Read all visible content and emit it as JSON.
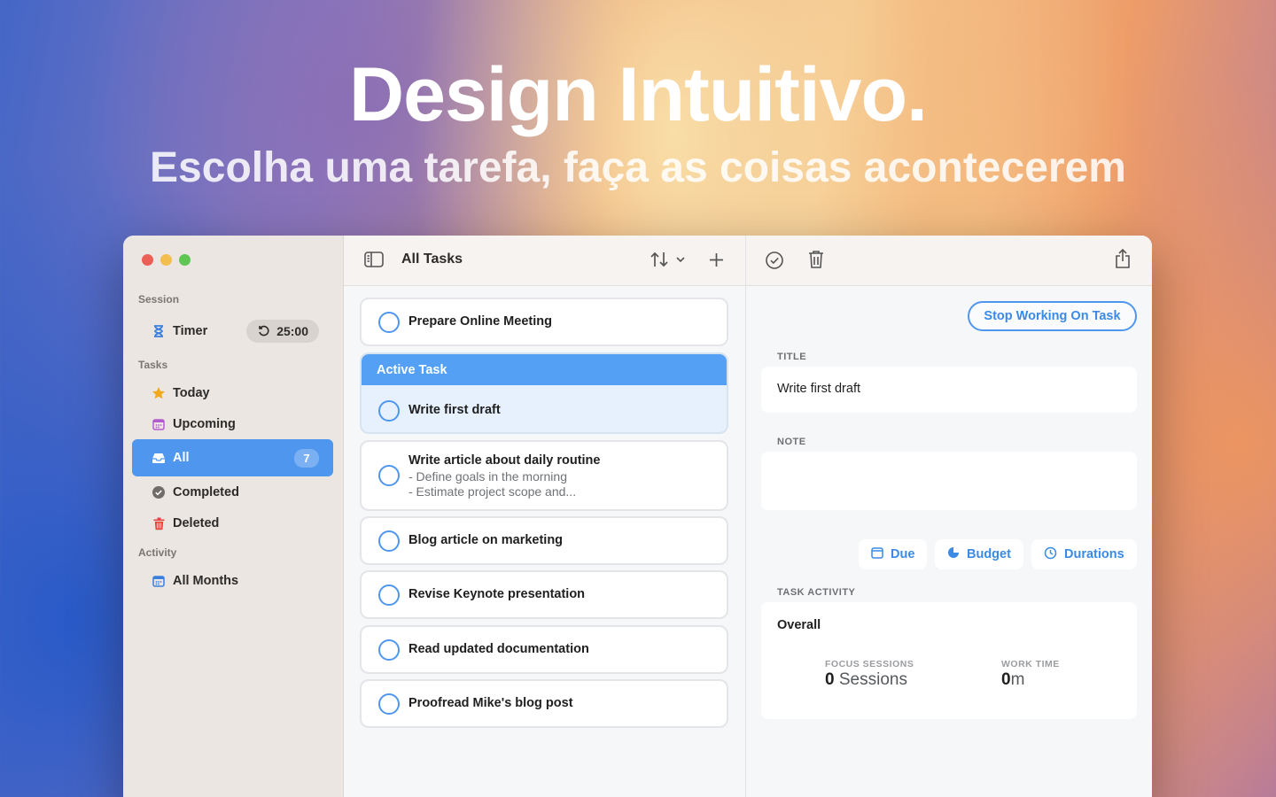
{
  "hero": {
    "title": "Design Intuitivo.",
    "subtitle": "Escolha uma tarefa, faça as coisas acontecerem"
  },
  "sidebar": {
    "session_label": "Session",
    "timer": {
      "label": "Timer",
      "value": "25:00"
    },
    "tasks_label": "Tasks",
    "items": [
      {
        "label": "Today",
        "icon": "star-icon"
      },
      {
        "label": "Upcoming",
        "icon": "calendar-icon"
      },
      {
        "label": "All",
        "icon": "tray-icon",
        "count": "7"
      },
      {
        "label": "Completed",
        "icon": "check-circle-icon"
      },
      {
        "label": "Deleted",
        "icon": "trash-icon"
      }
    ],
    "activity_label": "Activity",
    "activity_items": [
      {
        "label": "All Months",
        "icon": "calendar-icon"
      }
    ]
  },
  "task_list": {
    "title": "All Tasks",
    "active_header": "Active Task",
    "tasks": [
      {
        "title": "Prepare Online Meeting"
      },
      {
        "title": "Write first draft",
        "active": true
      },
      {
        "title": "Write article about daily routine",
        "note_lines": [
          "- Define goals in the morning",
          "- Estimate project scope and..."
        ]
      },
      {
        "title": "Blog article on marketing"
      },
      {
        "title": "Revise Keynote presentation"
      },
      {
        "title": "Read updated documentation"
      },
      {
        "title": "Proofread Mike's blog post"
      }
    ]
  },
  "detail": {
    "stop_button": "Stop Working On Task",
    "title_label": "TITLE",
    "title_value": "Write first draft",
    "note_label": "NOTE",
    "note_value": "",
    "chips": {
      "due": "Due",
      "budget": "Budget",
      "durations": "Durations"
    },
    "activity_label": "TASK ACTIVITY",
    "overall_label": "Overall",
    "focus_label": "FOCUS SESSIONS",
    "focus_number": "0",
    "focus_unit": " Sessions",
    "work_label": "WORK TIME",
    "work_number": "0",
    "work_unit": "m"
  },
  "colors": {
    "accent": "#4f97ee",
    "active_header": "#53a0f5",
    "sidebar_bg": "#ebe6e2"
  }
}
